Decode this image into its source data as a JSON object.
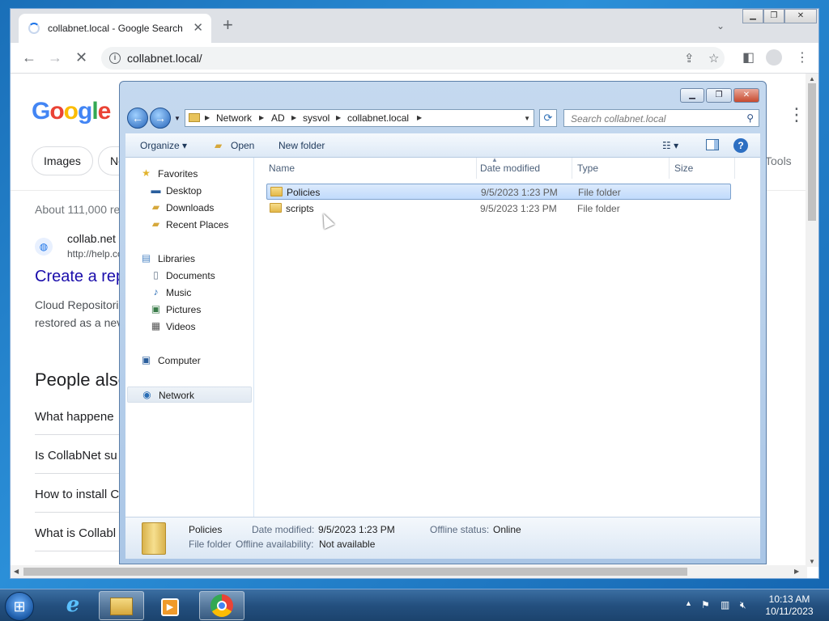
{
  "browser": {
    "tab_title": "collabnet.local - Google Search",
    "url": "collabnet.local/",
    "icons": {
      "back": "arrow-left-icon",
      "forward": "arrow-right-icon",
      "reload": "loading-stop-icon",
      "share": "share-icon",
      "bookmark": "star-icon",
      "sidepanel": "side-panel-icon",
      "profile": "profile-icon",
      "menu": "more-vert-icon"
    }
  },
  "google_page": {
    "logo": "Google",
    "chips": [
      "Images",
      "Ne"
    ],
    "tools": "Tools",
    "stats": "About 111,000 re",
    "result": {
      "site": "collab.net",
      "url": "http://help.co",
      "title": "Create a rep",
      "snippet_lines": [
        "Cloud Repositori",
        "restored as a nev"
      ]
    },
    "people_also_ask": {
      "title": "People also",
      "questions": [
        "What happene",
        "Is CollabNet su",
        "How to install C",
        "What is Collabl"
      ]
    }
  },
  "explorer": {
    "breadcrumb": [
      "Network",
      "AD",
      "sysvol",
      "collabnet.local"
    ],
    "search_placeholder": "Search collabnet.local",
    "commands": {
      "organize": "Organize",
      "open": "Open",
      "new_folder": "New folder"
    },
    "nav": {
      "favorites_header": "Favorites",
      "favorites": [
        "Desktop",
        "Downloads",
        "Recent Places"
      ],
      "libraries_header": "Libraries",
      "libraries": [
        "Documents",
        "Music",
        "Pictures",
        "Videos"
      ],
      "computer": "Computer",
      "network": "Network"
    },
    "columns": [
      "Name",
      "Date modified",
      "Type",
      "Size"
    ],
    "files": [
      {
        "name": "Policies",
        "date": "9/5/2023 1:23 PM",
        "type": "File folder",
        "size": ""
      },
      {
        "name": "scripts",
        "date": "9/5/2023 1:23 PM",
        "type": "File folder",
        "size": ""
      }
    ],
    "details": {
      "name": "Policies",
      "kind": "File folder",
      "date_label": "Date modified:",
      "date_value": "9/5/2023 1:23 PM",
      "offline_status_label": "Offline status:",
      "offline_status_value": "Online",
      "offline_avail_label": "Offline availability:",
      "offline_avail_value": "Not available"
    }
  },
  "taskbar": {
    "time": "10:13 AM",
    "date": "10/11/2023",
    "apps": [
      "internet-explorer-icon",
      "file-explorer-icon",
      "media-player-icon",
      "chrome-icon"
    ]
  }
}
